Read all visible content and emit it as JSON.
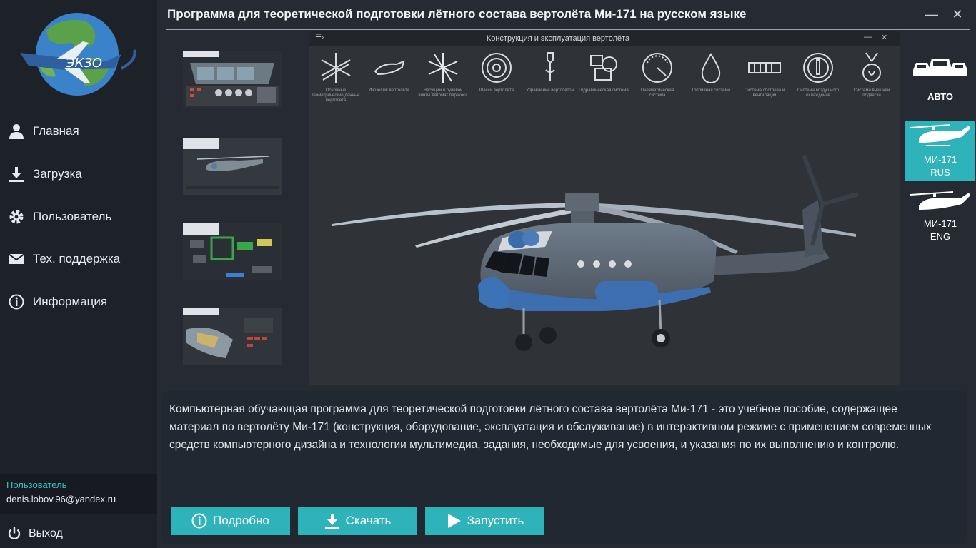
{
  "window": {
    "title": "Программа для теоретической подготовки лётного состава вертолёта Ми-171 на русском языке",
    "minimize": "—",
    "close": "✕"
  },
  "sidebar": {
    "logo_text": "ЭКЗО",
    "items": [
      {
        "label": "Главная",
        "icon": "user-icon"
      },
      {
        "label": "Загрузка",
        "icon": "download-icon"
      },
      {
        "label": "Пользователь",
        "icon": "gear-icon"
      },
      {
        "label": "Тех. поддержка",
        "icon": "mail-icon"
      },
      {
        "label": "Информация",
        "icon": "info-icon"
      }
    ],
    "user_caption": "Пользователь",
    "user_email": "denis.lobov.96@yandex.ru",
    "logout_label": "Выход"
  },
  "preview": {
    "menu_icon": "☰›",
    "title": "Конструкция и эксплуатация вертолёта",
    "minimize": "—",
    "close": "✕",
    "systems": [
      {
        "caption": "Основные геометрические данные вертолёта",
        "icon": "geometry-icon"
      },
      {
        "caption": "Фюзеляж вертолёта",
        "icon": "fuselage-icon"
      },
      {
        "caption": "Несущий и рулевой винты Автомат перекоса",
        "icon": "rotor-icon"
      },
      {
        "caption": "Шасси вертолёта",
        "icon": "wheel-icon"
      },
      {
        "caption": "Управление вертолётом",
        "icon": "control-stick-icon"
      },
      {
        "caption": "Гидравлическая система",
        "icon": "hydraulic-icon"
      },
      {
        "caption": "Пневматическая система",
        "icon": "gauge-icon"
      },
      {
        "caption": "Топливная система",
        "icon": "fuel-drop-icon"
      },
      {
        "caption": "Система обогрева и вентиляции",
        "icon": "heater-icon"
      },
      {
        "caption": "Система воздушного охлаждения",
        "icon": "fan-icon"
      },
      {
        "caption": "Система внешней подвески",
        "icon": "hook-icon"
      }
    ]
  },
  "thumbnails": [
    "screenshot-cockpit",
    "screenshot-helicopter",
    "screenshot-scheme",
    "screenshot-cutaway"
  ],
  "categories": [
    {
      "label": "АВТО",
      "sub": "",
      "icon": "cars-icon",
      "active": false
    },
    {
      "label": "МИ-171",
      "sub": "RUS",
      "icon": "helicopter-icon",
      "active": true
    },
    {
      "label": "МИ-171",
      "sub": "ENG",
      "icon": "helicopter-icon",
      "active": false
    }
  ],
  "description": "Компьютерная обучающая программа для теоретической подготовки лётного состава вертолёта Ми-171 - это учебное пособие, содержащее материал по вертолёту Ми-171 (конструкция, оборудование, эксплуатация и обслуживание) в интерактивном режиме с применением современных средств компьютерного дизайна и технологии мультимедиа, задания, необходимые для усвоения, и указания по их выполнению и контролю.",
  "buttons": {
    "details": "Подробно",
    "download": "Скачать",
    "launch": "Запустить"
  },
  "colors": {
    "accent": "#2fb3bb",
    "sidebar": "#1d2229",
    "background": "#262b33",
    "user_caption": "#35c2c9"
  }
}
